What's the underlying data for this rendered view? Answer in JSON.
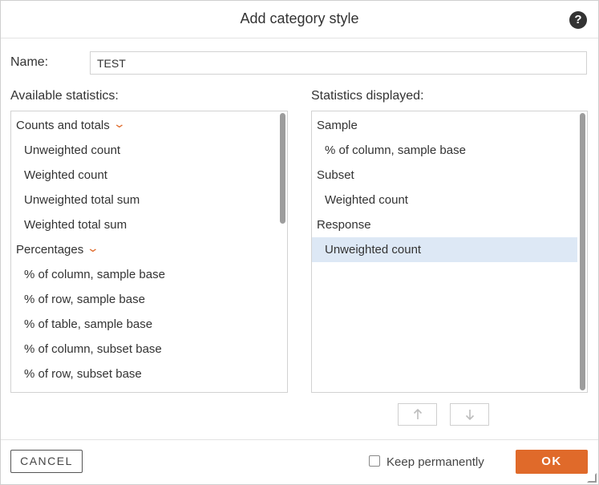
{
  "dialog": {
    "title": "Add category style",
    "help_icon": "?"
  },
  "name": {
    "label": "Name:",
    "value": "TEST"
  },
  "available": {
    "label": "Available statistics:",
    "rows": [
      {
        "type": "group",
        "label": "Counts and totals",
        "icon": "chevron-down-icon"
      },
      {
        "type": "item",
        "label": "Unweighted count"
      },
      {
        "type": "item",
        "label": "Weighted count"
      },
      {
        "type": "item",
        "label": "Unweighted total sum"
      },
      {
        "type": "item",
        "label": "Weighted total sum"
      },
      {
        "type": "group",
        "label": "Percentages",
        "icon": "chevron-down-icon"
      },
      {
        "type": "item",
        "label": "% of column, sample base"
      },
      {
        "type": "item",
        "label": "% of row, sample base"
      },
      {
        "type": "item",
        "label": "% of table, sample base"
      },
      {
        "type": "item",
        "label": "% of column, subset base"
      },
      {
        "type": "item",
        "label": "% of row, subset base"
      }
    ]
  },
  "displayed": {
    "label": "Statistics displayed:",
    "rows": [
      {
        "type": "group",
        "label": "Sample"
      },
      {
        "type": "item",
        "label": "% of column, sample base"
      },
      {
        "type": "group",
        "label": "Subset"
      },
      {
        "type": "item",
        "label": "Weighted count"
      },
      {
        "type": "group",
        "label": "Response"
      },
      {
        "type": "item",
        "label": "Unweighted count",
        "selected": true
      }
    ]
  },
  "move_buttons": {
    "up_icon": "arrow-up-icon",
    "down_icon": "arrow-down-icon"
  },
  "footer": {
    "cancel_label": "CANCEL",
    "keep_label": "Keep permanently",
    "keep_checked": false,
    "ok_label": "OK"
  },
  "colors": {
    "accent": "#e06a2a",
    "selection": "#dde8f5"
  }
}
